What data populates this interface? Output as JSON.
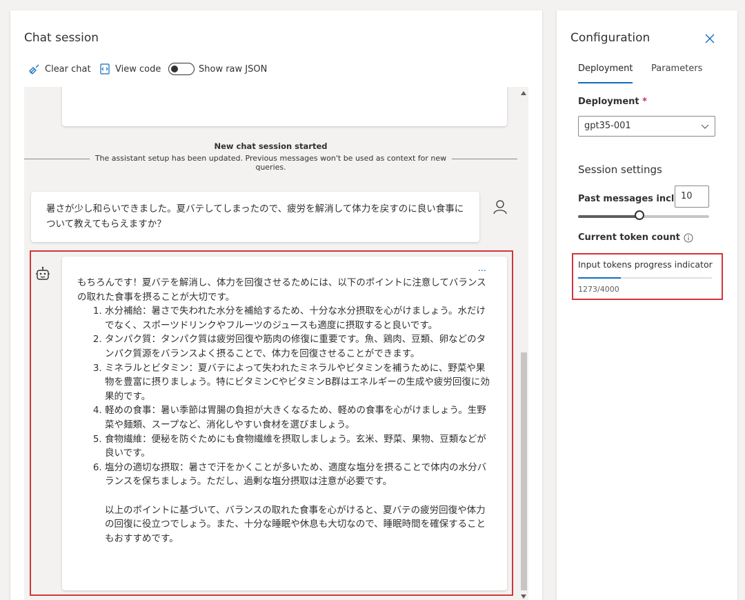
{
  "chat": {
    "title": "Chat session",
    "toolbar": {
      "clear_label": "Clear chat",
      "view_code_label": "View code",
      "raw_json_label": "Show raw JSON"
    },
    "session_notice": {
      "title": "New chat session started",
      "subtitle": "The assistant setup has been updated. Previous messages won't be used as context for new queries."
    },
    "user_message": "暑さが少し和らいできました。夏バテしてしまったので、疲労を解消して体力を戻すのに良い食事について教えてもらえますか？",
    "assistant_message": {
      "more_label": "...",
      "intro": "もちろんです！夏バテを解消し、体力を回復させるためには、以下のポイントに注意してバランスの取れた食事を摂ることが大切です。",
      "items": [
        "水分補給：暑さで失われた水分を補給するため、十分な水分摂取を心がけましょう。水だけでなく、スポーツドリンクやフルーツのジュースも適度に摂取すると良いです。",
        "タンパク質：タンパク質は疲労回復や筋肉の修復に重要です。魚、鶏肉、豆類、卵などのタンパク質源をバランスよく摂ることで、体力を回復させることができます。",
        "ミネラルとビタミン：夏バテによって失われたミネラルやビタミンを補うために、野菜や果物を豊富に摂りましょう。特にビタミンCやビタミンB群はエネルギーの生成や疲労回復に効果的です。",
        "軽めの食事：暑い季節は胃腸の負担が大きくなるため、軽めの食事を心がけましょう。生野菜や麺類、スープなど、消化しやすい食材を選びましょう。",
        "食物繊維：便秘を防ぐためにも食物繊維を摂取しましょう。玄米、野菜、果物、豆類などが良いです。",
        "塩分の適切な摂取：暑さで汗をかくことが多いため、適度な塩分を摂ることで体内の水分バランスを保ちましょう。ただし、過剰な塩分摂取は注意が必要です。"
      ],
      "conclusion": "以上のポイントに基づいて、バランスの取れた食事を心がけると、夏バテの疲労回復や体力の回復に役立つでしょう。また、十分な睡眠や休息も大切なので、睡眠時間を確保することもおすすめです。"
    }
  },
  "config": {
    "title": "Configuration",
    "close_icon": "close-icon",
    "tabs": [
      "Deployment",
      "Parameters"
    ],
    "active_tab": "Deployment",
    "deployment_label": "Deployment",
    "required_mark": "*",
    "deployment_value": "gpt35-001",
    "session_settings_title": "Session settings",
    "past_messages_label": "Past messages included",
    "past_messages_value": "10",
    "past_messages_slider_fraction": 0.47,
    "token_count_label": "Current token count",
    "progress_label": "Input tokens progress indicator",
    "progress_text": "1273/4000",
    "progress_fraction": 0.318
  },
  "colors": {
    "accent": "#0f6cbd",
    "highlight": "#d13438",
    "background": "#f3f2f1"
  }
}
